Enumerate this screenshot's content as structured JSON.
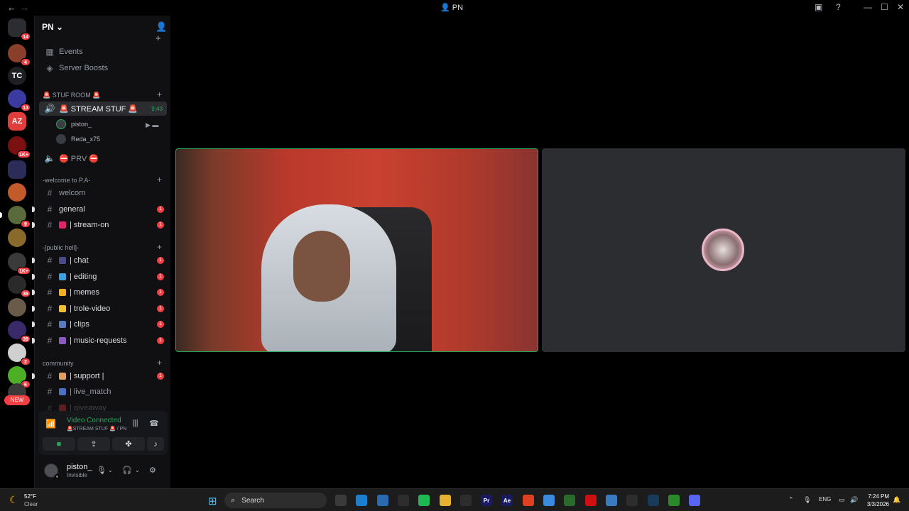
{
  "window": {
    "title": "PN",
    "back_icon": "arrow-left-icon",
    "forward_icon": "arrow-right-icon"
  },
  "server_rail": {
    "servers": [
      {
        "name": "direct-messages",
        "label": "",
        "badge": "14",
        "color": "#2b2d31"
      },
      {
        "name": "server-1",
        "label": "",
        "badge": "4",
        "color": "#8a3f2a"
      },
      {
        "name": "server-tc",
        "label": "TC",
        "badge": "",
        "color": "#1e1f22"
      },
      {
        "name": "server-3",
        "label": "",
        "badge": "13",
        "color": "#3a3aa0"
      },
      {
        "name": "server-az",
        "label": "AZ",
        "badge": "",
        "color": "#e23d3d"
      },
      {
        "name": "server-5",
        "label": "",
        "badge": "1K+",
        "color": "#7a1010"
      },
      {
        "name": "server-folder",
        "label": "",
        "badge": "",
        "color": "#2b2d58"
      },
      {
        "name": "server-7",
        "label": "",
        "badge": "",
        "color": "#c25a2a"
      },
      {
        "name": "server-8",
        "label": "",
        "badge": "9",
        "color": "#5a6a3a"
      },
      {
        "name": "server-9",
        "label": "",
        "badge": "",
        "color": "#8a6a2a"
      },
      {
        "name": "server-10",
        "label": "",
        "badge": "1K+",
        "color": "#3a3a3a"
      },
      {
        "name": "server-11",
        "label": "",
        "badge": "36",
        "color": "#2a2a2a"
      },
      {
        "name": "server-12",
        "label": "",
        "badge": "",
        "color": "#6a5a4a"
      },
      {
        "name": "server-13",
        "label": "",
        "badge": "39",
        "color": "#3a2a6a"
      },
      {
        "name": "server-14",
        "label": "",
        "badge": "2",
        "color": "#d0d0d0"
      },
      {
        "name": "server-15",
        "label": "",
        "badge": "6",
        "color": "#4caf24"
      },
      {
        "name": "server-16",
        "label": "",
        "badge": "",
        "color": "#3a3a3a"
      }
    ],
    "new_label": "NEW"
  },
  "server": {
    "name": "PN",
    "top_links": [
      {
        "label": "Events",
        "icon": "calendar-icon"
      },
      {
        "label": "Server Boosts",
        "icon": "boost-icon"
      }
    ],
    "categories": {
      "stuf_room": "🚨 STUF ROOM 🚨",
      "welcome": "-welcome to P.A-",
      "public_hell": "-[public hell]-",
      "community": "community"
    },
    "voice_channels": {
      "stream": {
        "label": "🚨 STREAM STUF 🚨",
        "time": "9:43"
      },
      "prv": {
        "label": "⛔ PRV ⛔"
      }
    },
    "voice_users": [
      {
        "name": "piston_"
      },
      {
        "name": "Reda_x75"
      }
    ],
    "text_channels": [
      {
        "label": "welcom",
        "unread": "",
        "emoji": ""
      },
      {
        "label": "general",
        "unread": "1",
        "emoji": ""
      },
      {
        "label": "| stream-on",
        "unread": "1",
        "emoji": "#e2246a"
      },
      {
        "label": "| chat",
        "unread": "1",
        "emoji": "#4a4a8a"
      },
      {
        "label": "| editing",
        "unread": "1",
        "emoji": "#3aa0e0"
      },
      {
        "label": "| memes",
        "unread": "1",
        "emoji": "#f0b020"
      },
      {
        "label": "| trole-video",
        "unread": "1",
        "emoji": "#f0c030"
      },
      {
        "label": "| clips",
        "unread": "1",
        "emoji": "#5a7ac0"
      },
      {
        "label": "| music-requests",
        "unread": "1",
        "emoji": "#8a5ac0"
      },
      {
        "label": "| support |",
        "unread": "1",
        "emoji": "#e0a060"
      },
      {
        "label": "| live_match",
        "unread": "",
        "emoji": "#4a70c0"
      },
      {
        "label": "| giveaway",
        "unread": "",
        "emoji": "#e04040"
      }
    ]
  },
  "voice_panel": {
    "status": "Video Connected",
    "location": "🚨STREAM STUF 🚨 / PN"
  },
  "user": {
    "name": "piston_",
    "status": "Invisible"
  },
  "taskbar": {
    "temperature": "52°F",
    "condition": "Clear",
    "search_placeholder": "Search",
    "language": "ENG",
    "time": "7:24 PM",
    "date": "3/3/2026",
    "apps": [
      {
        "name": "file-explorer",
        "label": "",
        "color": "#3a3a3a"
      },
      {
        "name": "edge",
        "label": "",
        "color": "#1a7fd0"
      },
      {
        "name": "store",
        "label": "",
        "color": "#2a6ab0"
      },
      {
        "name": "pen-app",
        "label": "",
        "color": "#2d2d2d"
      },
      {
        "name": "spotify",
        "label": "",
        "color": "#1db954"
      },
      {
        "name": "folder",
        "label": "",
        "color": "#e8b030"
      },
      {
        "name": "capcut",
        "label": "",
        "color": "#2d2d2d"
      },
      {
        "name": "premiere",
        "label": "Pr",
        "color": "#1a1a60"
      },
      {
        "name": "after-effects",
        "label": "Ae",
        "color": "#1a1a60"
      },
      {
        "name": "brave",
        "label": "",
        "color": "#e04020"
      },
      {
        "name": "chrome",
        "label": "",
        "color": "#3a8ae0"
      },
      {
        "name": "app-green",
        "label": "",
        "color": "#2a6a2a"
      },
      {
        "name": "record",
        "label": "",
        "color": "#d01010"
      },
      {
        "name": "notepad",
        "label": "",
        "color": "#3a7ac0"
      },
      {
        "name": "github",
        "label": "",
        "color": "#2d2d2d"
      },
      {
        "name": "steam",
        "label": "",
        "color": "#1a3a5a"
      },
      {
        "name": "xbox",
        "label": "",
        "color": "#2a8a2a"
      },
      {
        "name": "discord",
        "label": "",
        "color": "#5865f2"
      }
    ]
  }
}
